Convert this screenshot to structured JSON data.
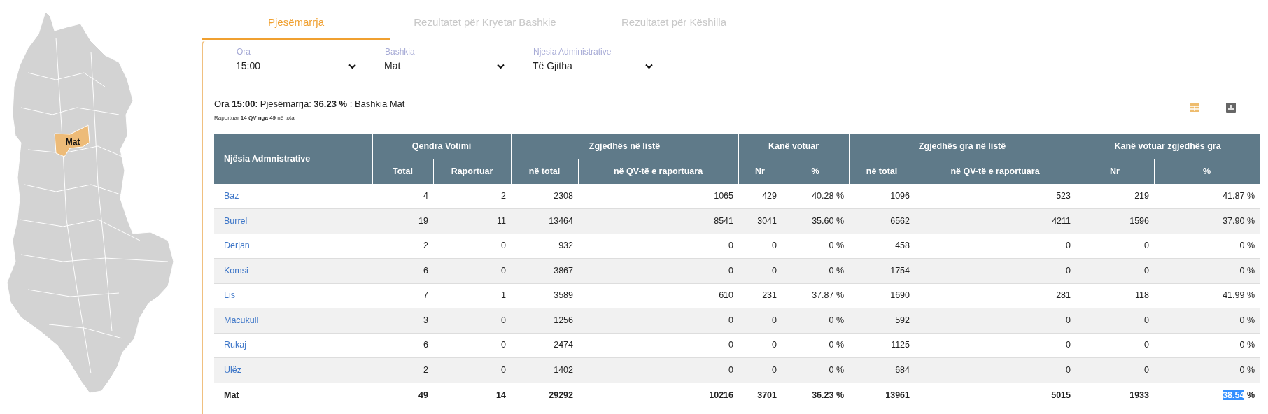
{
  "map": {
    "highlighted_region": "Mat"
  },
  "tabs": [
    {
      "label": "Pjesëmarrja",
      "selected": true
    },
    {
      "label": "Rezultatet për Kryetar Bashkie",
      "selected": false
    },
    {
      "label": "Rezultatet për Këshilla",
      "selected": false
    }
  ],
  "filters": [
    {
      "label": "Ora",
      "value": "15:00"
    },
    {
      "label": "Bashkia",
      "value": "Mat"
    },
    {
      "label": "Njesia Administrative",
      "value": "Të Gjitha"
    }
  ],
  "summary": "Ora **15:00**: Pjesëmarrja: **36.23 %** : Bashkia Mat",
  "reported_note": "Raportuar **14 QV nga 49** në total",
  "view_toggles": [
    {
      "kind": "table",
      "selected": true
    },
    {
      "kind": "chart",
      "selected": false
    }
  ],
  "table": {
    "first_column": "Njësia Admnistrative",
    "groups": [
      {
        "label": "Qendra Votimi",
        "columns": [
          "Total",
          "Raportuar"
        ]
      },
      {
        "label": "Zgjedhës në listë",
        "columns": [
          "në total",
          "në QV-të e raportuara"
        ]
      },
      {
        "label": "Kanë votuar",
        "columns": [
          "Nr",
          "%"
        ]
      },
      {
        "label": "Zgjedhës gra në listë",
        "columns": [
          "në total",
          "në QV-të e raportuara"
        ]
      },
      {
        "label": "Kanë votuar zgjedhës gra",
        "columns": [
          "Nr",
          "%"
        ]
      }
    ],
    "rows": [
      {
        "name": "Baz",
        "cells": [
          "4",
          "2",
          "2308",
          "1065",
          "429",
          "40.28 %",
          "1096",
          "523",
          "219",
          "41.87 %"
        ]
      },
      {
        "name": "Burrel",
        "cells": [
          "19",
          "11",
          "13464",
          "8541",
          "3041",
          "35.60 %",
          "6562",
          "4211",
          "1596",
          "37.90 %"
        ]
      },
      {
        "name": "Derjan",
        "cells": [
          "2",
          "0",
          "932",
          "0",
          "0",
          "0 %",
          "458",
          "0",
          "0",
          "0 %"
        ]
      },
      {
        "name": "Komsi",
        "cells": [
          "6",
          "0",
          "3867",
          "0",
          "0",
          "0 %",
          "1754",
          "0",
          "0",
          "0 %"
        ]
      },
      {
        "name": "Lis",
        "cells": [
          "7",
          "1",
          "3589",
          "610",
          "231",
          "37.87 %",
          "1690",
          "281",
          "118",
          "41.99 %"
        ]
      },
      {
        "name": "Macukull",
        "cells": [
          "3",
          "0",
          "1256",
          "0",
          "0",
          "0 %",
          "592",
          "0",
          "0",
          "0 %"
        ]
      },
      {
        "name": "Rukaj",
        "cells": [
          "6",
          "0",
          "2474",
          "0",
          "0",
          "0 %",
          "1125",
          "0",
          "0",
          "0 %"
        ]
      },
      {
        "name": "Ulëz",
        "cells": [
          "2",
          "0",
          "1402",
          "0",
          "0",
          "0 %",
          "684",
          "0",
          "0",
          "0 %"
        ]
      }
    ],
    "total": {
      "name": "Mat",
      "cells": [
        "49",
        "14",
        "29292",
        "10216",
        "3701",
        "36.23 %",
        "13961",
        "5015",
        "1933",
        "38.54 %"
      ],
      "last_cell_number_selected": true
    }
  }
}
